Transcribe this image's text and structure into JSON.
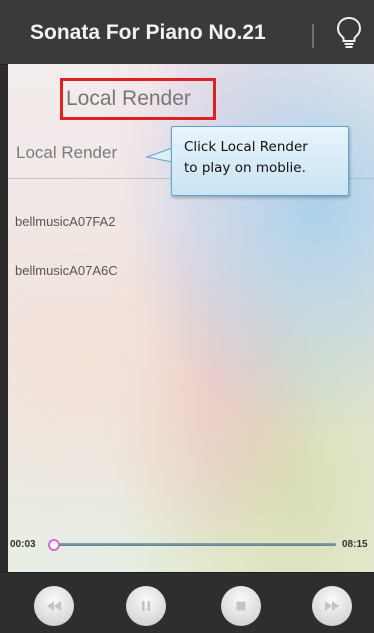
{
  "header": {
    "title": "Sonata For Piano No.21",
    "action_icon": "lightbulb-icon"
  },
  "panel": {
    "heading": "Local Render",
    "section_label": "Local Render",
    "callout": {
      "line1": "Click Local Render",
      "line2": "to play on moblie."
    },
    "highlight_color": "#e02020",
    "devices": [
      {
        "name": "bellmusicA07FA2"
      },
      {
        "name": "bellmusicA07A6C"
      }
    ]
  },
  "player": {
    "current_time": "00:03",
    "total_time": "08:15",
    "progress_fraction": 0.006,
    "controls": [
      {
        "name": "previous",
        "icon": "rewind-icon"
      },
      {
        "name": "pause",
        "icon": "pause-icon"
      },
      {
        "name": "stop",
        "icon": "stop-icon"
      },
      {
        "name": "next",
        "icon": "fast-forward-icon"
      }
    ]
  },
  "colors": {
    "titlebar": "#3a3a3a",
    "controlbar": "#2e2e2e",
    "progress_thumb": "#d66ad6",
    "callout_border": "#5fa3cf"
  }
}
